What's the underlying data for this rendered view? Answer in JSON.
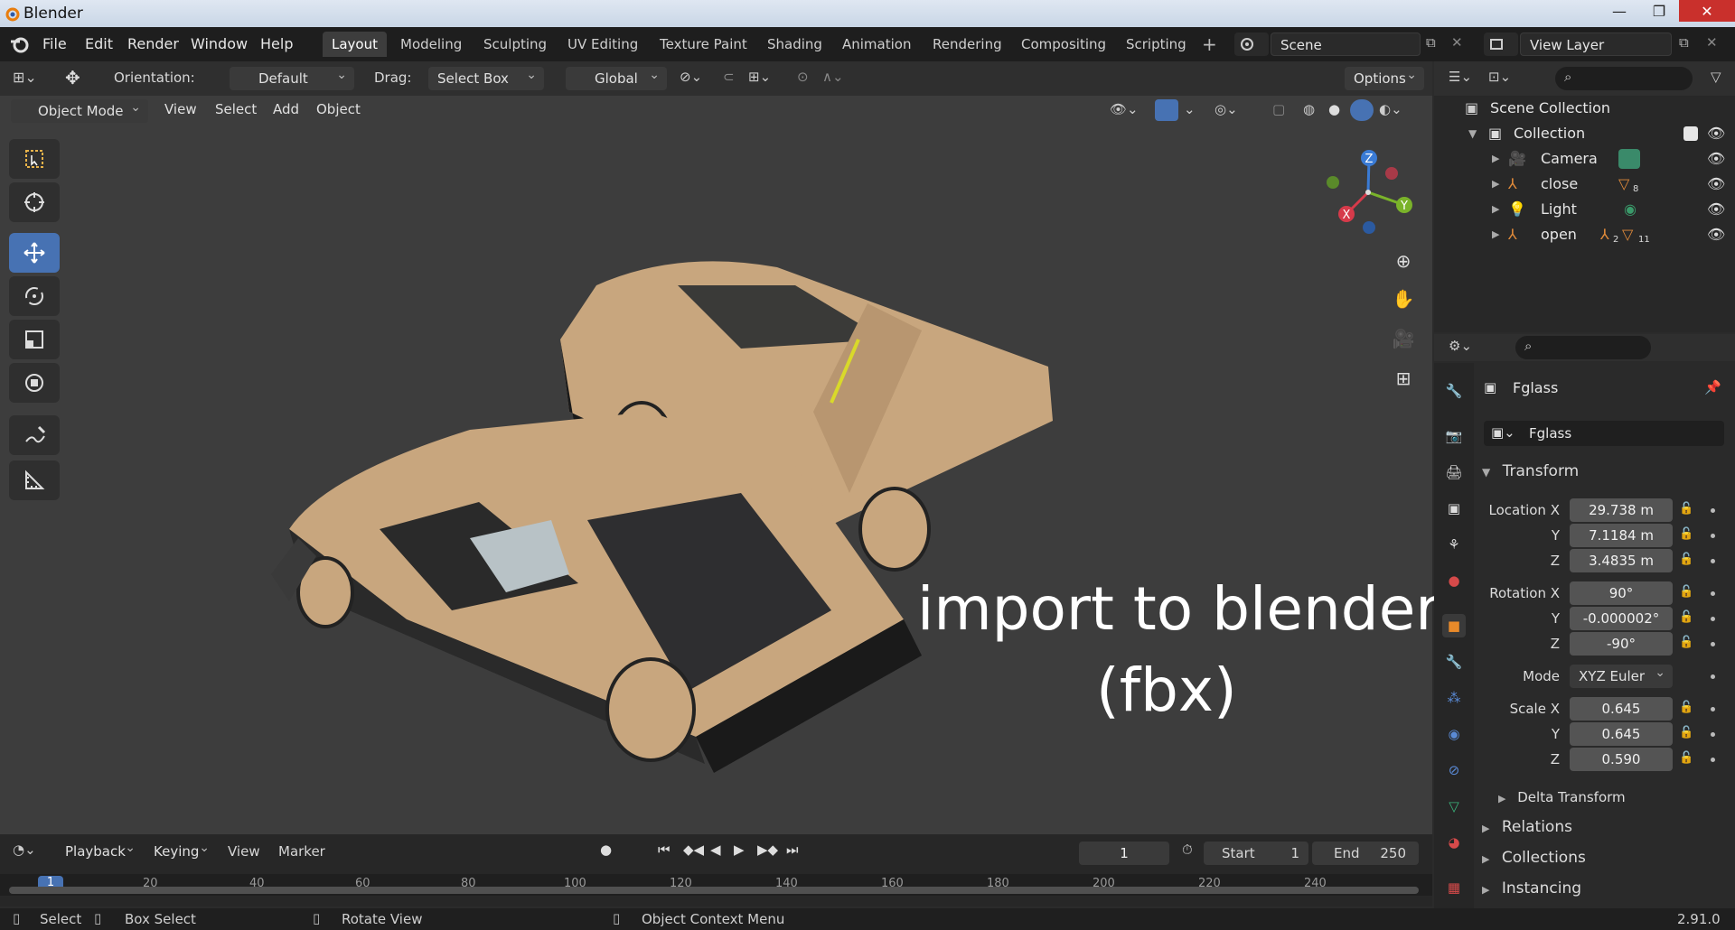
{
  "window": {
    "title": "Blender",
    "controls": [
      "—",
      "❐",
      "✕"
    ]
  },
  "menu": {
    "items": [
      "File",
      "Edit",
      "Render",
      "Window",
      "Help"
    ]
  },
  "workspaces": [
    "Layout",
    "Modeling",
    "Sculpting",
    "UV Editing",
    "Texture Paint",
    "Shading",
    "Animation",
    "Rendering",
    "Compositing",
    "Scripting"
  ],
  "active_workspace": "Layout",
  "scene": {
    "name": "Scene",
    "view_layer": "View Layer"
  },
  "tool_header": {
    "orientation_label": "Orientation:",
    "orientation_value": "Default",
    "drag_label": "Drag:",
    "drag_value": "Select Box",
    "transform_orientation": "Global",
    "options": "Options"
  },
  "viewport_header": {
    "mode": "Object Mode",
    "menus": [
      "View",
      "Select",
      "Add",
      "Object"
    ]
  },
  "overlay_text": {
    "line1": "import to blender",
    "line2": "(fbx)"
  },
  "gizmo": {
    "x": "X",
    "y": "Y",
    "z": "Z"
  },
  "outliner": {
    "scene_collection": "Scene Collection",
    "collection": "Collection",
    "items": [
      {
        "name": "Camera",
        "badge": ""
      },
      {
        "name": "close",
        "badge": "8"
      },
      {
        "name": "Light",
        "badge": ""
      },
      {
        "name": "open",
        "badge_a": "2",
        "badge_b": "11"
      }
    ]
  },
  "properties": {
    "object_name": "Fglass",
    "data_name": "Fglass",
    "transform_title": "Transform",
    "location_label": "Location X",
    "location": {
      "x": "29.738 m",
      "y": "7.1184 m",
      "z": "3.4835 m"
    },
    "rotation_label": "Rotation X",
    "rotation": {
      "x": "90°",
      "y": "-0.000002°",
      "z": "-90°"
    },
    "mode_label": "Mode",
    "mode_value": "XYZ Euler",
    "scale_label": "Scale X",
    "scale": {
      "x": "0.645",
      "y": "0.645",
      "z": "0.590"
    },
    "axis_y": "Y",
    "axis_z": "Z",
    "delta_transform": "Delta Transform",
    "sections": [
      "Relations",
      "Collections",
      "Instancing"
    ]
  },
  "timeline": {
    "menus": [
      "Playback",
      "Keying",
      "View",
      "Marker"
    ],
    "current_frame": "1",
    "start_label": "Start",
    "start_value": "1",
    "end_label": "End",
    "end_value": "250",
    "ruler": [
      "1",
      "20",
      "40",
      "60",
      "80",
      "100",
      "120",
      "140",
      "160",
      "180",
      "200",
      "220",
      "240"
    ]
  },
  "statusbar": {
    "select": "Select",
    "box_select": "Box Select",
    "rotate_view": "Rotate View",
    "context_menu": "Object Context Menu",
    "version": "2.91.0"
  }
}
